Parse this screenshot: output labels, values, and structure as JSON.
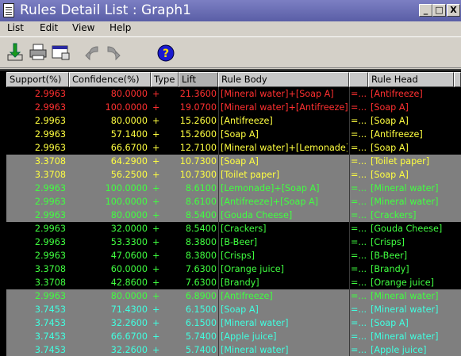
{
  "window": {
    "title": "Rules Detail List : Graph1"
  },
  "window_buttons": {
    "minimize": "_",
    "maximize": "□",
    "close": "X"
  },
  "menu": [
    "List",
    "Edit",
    "View",
    "Help"
  ],
  "toolbar": {
    "buttons": [
      "import-icon",
      "print-icon",
      "window-icon",
      "back-icon",
      "forward-icon",
      "help-icon"
    ],
    "help_glyph": "?"
  },
  "columns": [
    "Support(%)",
    "Confidence(%)",
    "Type",
    "Lift",
    "Rule Body",
    "",
    "Rule Head"
  ],
  "colors": {
    "red": "#ff3030",
    "yellow": "#ffff40",
    "green": "#40ff40",
    "cyan": "#40ffe0",
    "dark_bg": "#000000",
    "grey_bg": "#7f7f7f"
  },
  "rows": [
    {
      "bg": "dark",
      "color": "red",
      "support": "2.9963",
      "confidence": "80.0000",
      "type": "+",
      "lift": "21.3600",
      "body": "[Mineral water]+[Soap A]",
      "arrow": "=...",
      "head": "[Antifreeze]"
    },
    {
      "bg": "dark",
      "color": "red",
      "support": "2.9963",
      "confidence": "100.0000",
      "type": "+",
      "lift": "19.0700",
      "body": "[Mineral water]+[Antifreeze]",
      "arrow": "=...",
      "head": "[Soap A]"
    },
    {
      "bg": "dark",
      "color": "yellow",
      "support": "2.9963",
      "confidence": "80.0000",
      "type": "+",
      "lift": "15.2600",
      "body": "[Antifreeze]",
      "arrow": "=...",
      "head": "[Soap A]"
    },
    {
      "bg": "dark",
      "color": "yellow",
      "support": "2.9963",
      "confidence": "57.1400",
      "type": "+",
      "lift": "15.2600",
      "body": "[Soap A]",
      "arrow": "=...",
      "head": "[Antifreeze]"
    },
    {
      "bg": "dark",
      "color": "yellow",
      "support": "2.9963",
      "confidence": "66.6700",
      "type": "+",
      "lift": "12.7100",
      "body": "[Mineral water]+[Lemonade]",
      "arrow": "=...",
      "head": "[Soap A]"
    },
    {
      "bg": "grey",
      "color": "yellow",
      "support": "3.3708",
      "confidence": "64.2900",
      "type": "+",
      "lift": "10.7300",
      "body": "[Soap A]",
      "arrow": "=...",
      "head": "[Toilet paper]"
    },
    {
      "bg": "grey",
      "color": "yellow",
      "support": "3.3708",
      "confidence": "56.2500",
      "type": "+",
      "lift": "10.7300",
      "body": "[Toilet paper]",
      "arrow": "=...",
      "head": "[Soap A]"
    },
    {
      "bg": "grey",
      "color": "green",
      "support": "2.9963",
      "confidence": "100.0000",
      "type": "+",
      "lift": "8.6100",
      "body": "[Lemonade]+[Soap A]",
      "arrow": "=...",
      "head": "[Mineral water]"
    },
    {
      "bg": "grey",
      "color": "green",
      "support": "2.9963",
      "confidence": "100.0000",
      "type": "+",
      "lift": "8.6100",
      "body": "[Antifreeze]+[Soap A]",
      "arrow": "=...",
      "head": "[Mineral water]"
    },
    {
      "bg": "grey",
      "color": "green",
      "support": "2.9963",
      "confidence": "80.0000",
      "type": "+",
      "lift": "8.5400",
      "body": "[Gouda Cheese]",
      "arrow": "=...",
      "head": "[Crackers]"
    },
    {
      "bg": "dark",
      "color": "green",
      "support": "2.9963",
      "confidence": "32.0000",
      "type": "+",
      "lift": "8.5400",
      "body": "[Crackers]",
      "arrow": "=...",
      "head": "[Gouda Cheese]"
    },
    {
      "bg": "dark",
      "color": "green",
      "support": "2.9963",
      "confidence": "53.3300",
      "type": "+",
      "lift": "8.3800",
      "body": "[B-Beer]",
      "arrow": "=...",
      "head": "[Crisps]"
    },
    {
      "bg": "dark",
      "color": "green",
      "support": "2.9963",
      "confidence": "47.0600",
      "type": "+",
      "lift": "8.3800",
      "body": "[Crisps]",
      "arrow": "=...",
      "head": "[B-Beer]"
    },
    {
      "bg": "dark",
      "color": "green",
      "support": "3.3708",
      "confidence": "60.0000",
      "type": "+",
      "lift": "7.6300",
      "body": "[Orange juice]",
      "arrow": "=...",
      "head": "[Brandy]"
    },
    {
      "bg": "dark",
      "color": "green",
      "support": "3.3708",
      "confidence": "42.8600",
      "type": "+",
      "lift": "7.6300",
      "body": "[Brandy]",
      "arrow": "=...",
      "head": "[Orange juice]"
    },
    {
      "bg": "grey",
      "color": "green",
      "support": "2.9963",
      "confidence": "80.0000",
      "type": "+",
      "lift": "6.8900",
      "body": "[Antifreeze]",
      "arrow": "=...",
      "head": "[Mineral water]"
    },
    {
      "bg": "grey",
      "color": "cyan",
      "support": "3.7453",
      "confidence": "71.4300",
      "type": "+",
      "lift": "6.1500",
      "body": "[Soap A]",
      "arrow": "=...",
      "head": "[Mineral water]"
    },
    {
      "bg": "grey",
      "color": "cyan",
      "support": "3.7453",
      "confidence": "32.2600",
      "type": "+",
      "lift": "6.1500",
      "body": "[Mineral water]",
      "arrow": "=...",
      "head": "[Soap A]"
    },
    {
      "bg": "grey",
      "color": "cyan",
      "support": "3.7453",
      "confidence": "66.6700",
      "type": "+",
      "lift": "5.7400",
      "body": "[Apple juice]",
      "arrow": "=...",
      "head": "[Mineral water]"
    },
    {
      "bg": "grey",
      "color": "cyan",
      "support": "3.7453",
      "confidence": "32.2600",
      "type": "+",
      "lift": "5.7400",
      "body": "[Mineral water]",
      "arrow": "=...",
      "head": "[Apple juice]"
    }
  ]
}
